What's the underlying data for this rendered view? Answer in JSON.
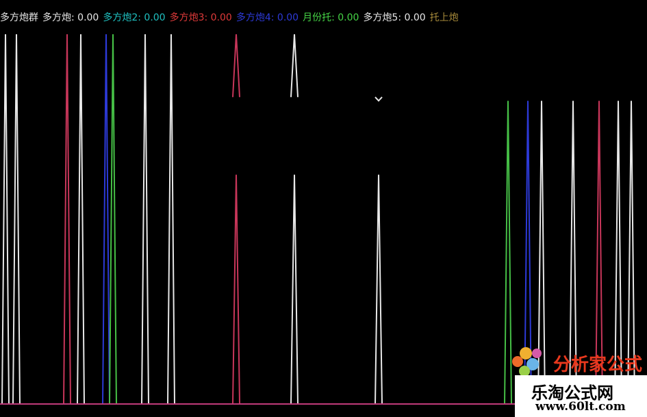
{
  "legend": {
    "group_label": "多方炮群",
    "items": [
      {
        "label": "多方炮: 0.00",
        "color": "#e8e8e8"
      },
      {
        "label": "多方炮2: 0.00",
        "color": "#1fc1c1"
      },
      {
        "label": "多方炮3: 0.00",
        "color": "#e03a3a"
      },
      {
        "label": "多方炮4: 0.00",
        "color": "#2d3ad8"
      },
      {
        "label": "月份托: 0.00",
        "color": "#46d446"
      },
      {
        "label": "多方炮5: 0.00",
        "color": "#e8e8e8"
      },
      {
        "label": "托上炮",
        "color": "#a68a3a"
      }
    ]
  },
  "watermark": {
    "cn_name": "分析家公式网",
    "title": "乐淘公式网",
    "url": "www.60lt.com"
  },
  "chart_data": {
    "type": "line",
    "title": "",
    "xlabel": "",
    "ylabel": "",
    "ylim": [
      0,
      1
    ],
    "note_spikes": "signal spikes rising from baseline; values are heights in the y range [0,1]",
    "series": [
      {
        "name": "多方炮",
        "color": "#e8e8e8"
      },
      {
        "name": "多方炮3",
        "color": "#c8365a"
      },
      {
        "name": "多方炮4",
        "color": "#2d3ad8"
      },
      {
        "name": "月份托",
        "color": "#46c046"
      }
    ],
    "spikes": [
      {
        "x": 8,
        "series": 0,
        "value": 1.0
      },
      {
        "x": 24,
        "series": 0,
        "value": 1.0
      },
      {
        "x": 98,
        "series": 1,
        "value": 1.0
      },
      {
        "x": 118,
        "series": 0,
        "value": 1.0
      },
      {
        "x": 155,
        "series": 2,
        "value": 1.0
      },
      {
        "x": 165,
        "series": 3,
        "value": 1.0
      },
      {
        "x": 212,
        "series": 0,
        "value": 1.0
      },
      {
        "x": 250,
        "series": 0,
        "value": 1.0
      },
      {
        "x": 345,
        "series": 1,
        "value": 1.0,
        "gap": [
          0.62,
          0.83
        ]
      },
      {
        "x": 430,
        "series": 0,
        "value": 1.0,
        "gap": [
          0.62,
          0.83
        ]
      },
      {
        "x": 553,
        "series": 0,
        "value": 0.82,
        "gap": [
          0.62,
          0.83
        ]
      },
      {
        "x": 742,
        "series": 3,
        "value": 0.82
      },
      {
        "x": 771,
        "series": 2,
        "value": 0.82
      },
      {
        "x": 791,
        "series": 0,
        "value": 0.82
      },
      {
        "x": 837,
        "series": 0,
        "value": 0.82
      },
      {
        "x": 875,
        "series": 1,
        "value": 0.82
      },
      {
        "x": 903,
        "series": 0,
        "value": 0.82
      },
      {
        "x": 922,
        "series": 0,
        "value": 0.82
      }
    ],
    "baseline_color": "#c03a7a"
  }
}
